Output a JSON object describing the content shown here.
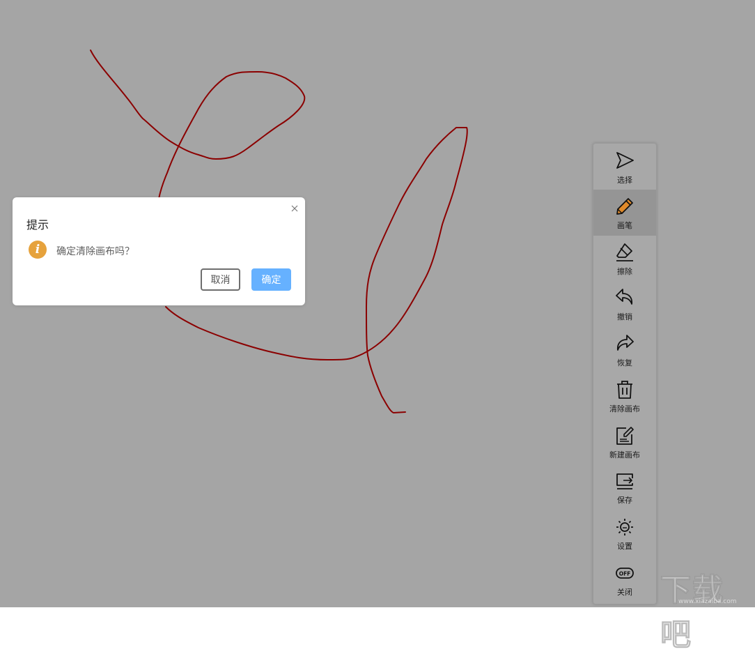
{
  "canvas": {
    "background": "#a5a5a5",
    "stroke_color": "#8b0000"
  },
  "dialog": {
    "title": "提示",
    "message": "确定清除画布吗？",
    "icon": "info-icon",
    "icon_color": "#e6a23c",
    "cancel_label": "取消",
    "confirm_label": "确定",
    "confirm_color": "#66b1ff"
  },
  "toolbar": {
    "active": "画笔",
    "items": [
      {
        "label": "选择",
        "icon": "cursor-arrow-icon"
      },
      {
        "label": "画笔",
        "icon": "pencil-icon"
      },
      {
        "label": "擦除",
        "icon": "eraser-icon"
      },
      {
        "label": "撤销",
        "icon": "undo-icon"
      },
      {
        "label": "恢复",
        "icon": "redo-icon"
      },
      {
        "label": "清除画布",
        "icon": "trash-icon"
      },
      {
        "label": "新建画布",
        "icon": "new-canvas-icon"
      },
      {
        "label": "保存",
        "icon": "save-icon"
      },
      {
        "label": "设置",
        "icon": "settings-sun-icon"
      },
      {
        "label": "关闭",
        "icon": "off-toggle-icon"
      }
    ]
  },
  "watermark": {
    "text": "下载吧",
    "url": "www.xiazaiba.com"
  }
}
